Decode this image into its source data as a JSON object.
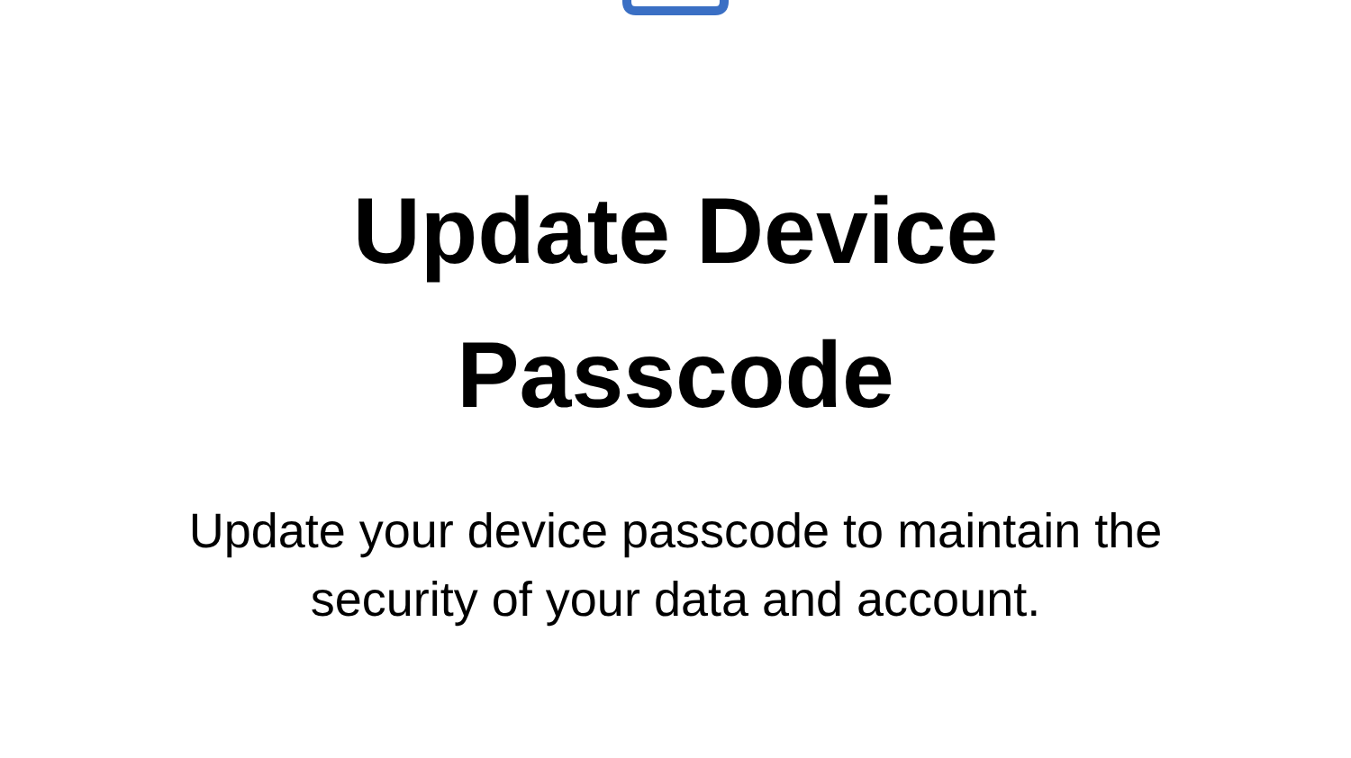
{
  "title": "Update Device Passcode",
  "description": "Update your device passcode to maintain the security of your data and account."
}
